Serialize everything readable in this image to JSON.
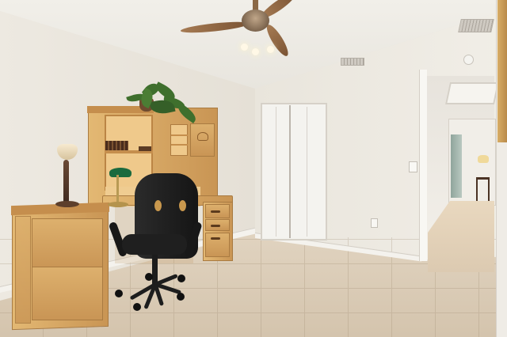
{
  "scene": {
    "palette": {
      "wall": "#e9e5dc",
      "floor_tile": "#d9ccb8",
      "desk_wood": "#d9a962",
      "chair": "#1f1f1f",
      "plant": "#3f6f2d",
      "desk_lamp_shade": "#1b6a3e"
    },
    "objects": [
      "ceiling-fan",
      "ceiling-vent",
      "smoke-detector",
      "bifold-closet-doors",
      "light-switch",
      "wall-outlet",
      "hallway-doorway",
      "wood-hutch-desk",
      "file-cabinet",
      "potted-plant",
      "table-lamp",
      "bankers-desk-lamp",
      "office-chair",
      "tile-floor"
    ]
  }
}
